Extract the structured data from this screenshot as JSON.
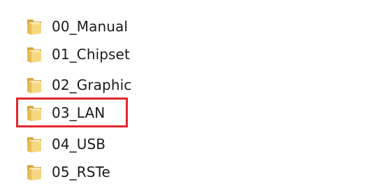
{
  "folders": [
    {
      "name": "00_Manual",
      "icon": "folder-icon"
    },
    {
      "name": "01_Chipset",
      "icon": "folder-icon"
    },
    {
      "name": "02_Graphic",
      "icon": "folder-icon"
    },
    {
      "name": "03_LAN",
      "icon": "folder-icon",
      "highlighted": true
    },
    {
      "name": "04_USB",
      "icon": "folder-icon"
    },
    {
      "name": "05_RSTe",
      "icon": "folder-icon"
    }
  ],
  "colors": {
    "highlight": "#e3262c",
    "folder_front": "#f3d27a",
    "folder_back": "#dcae45",
    "text": "#1a1a1a"
  }
}
